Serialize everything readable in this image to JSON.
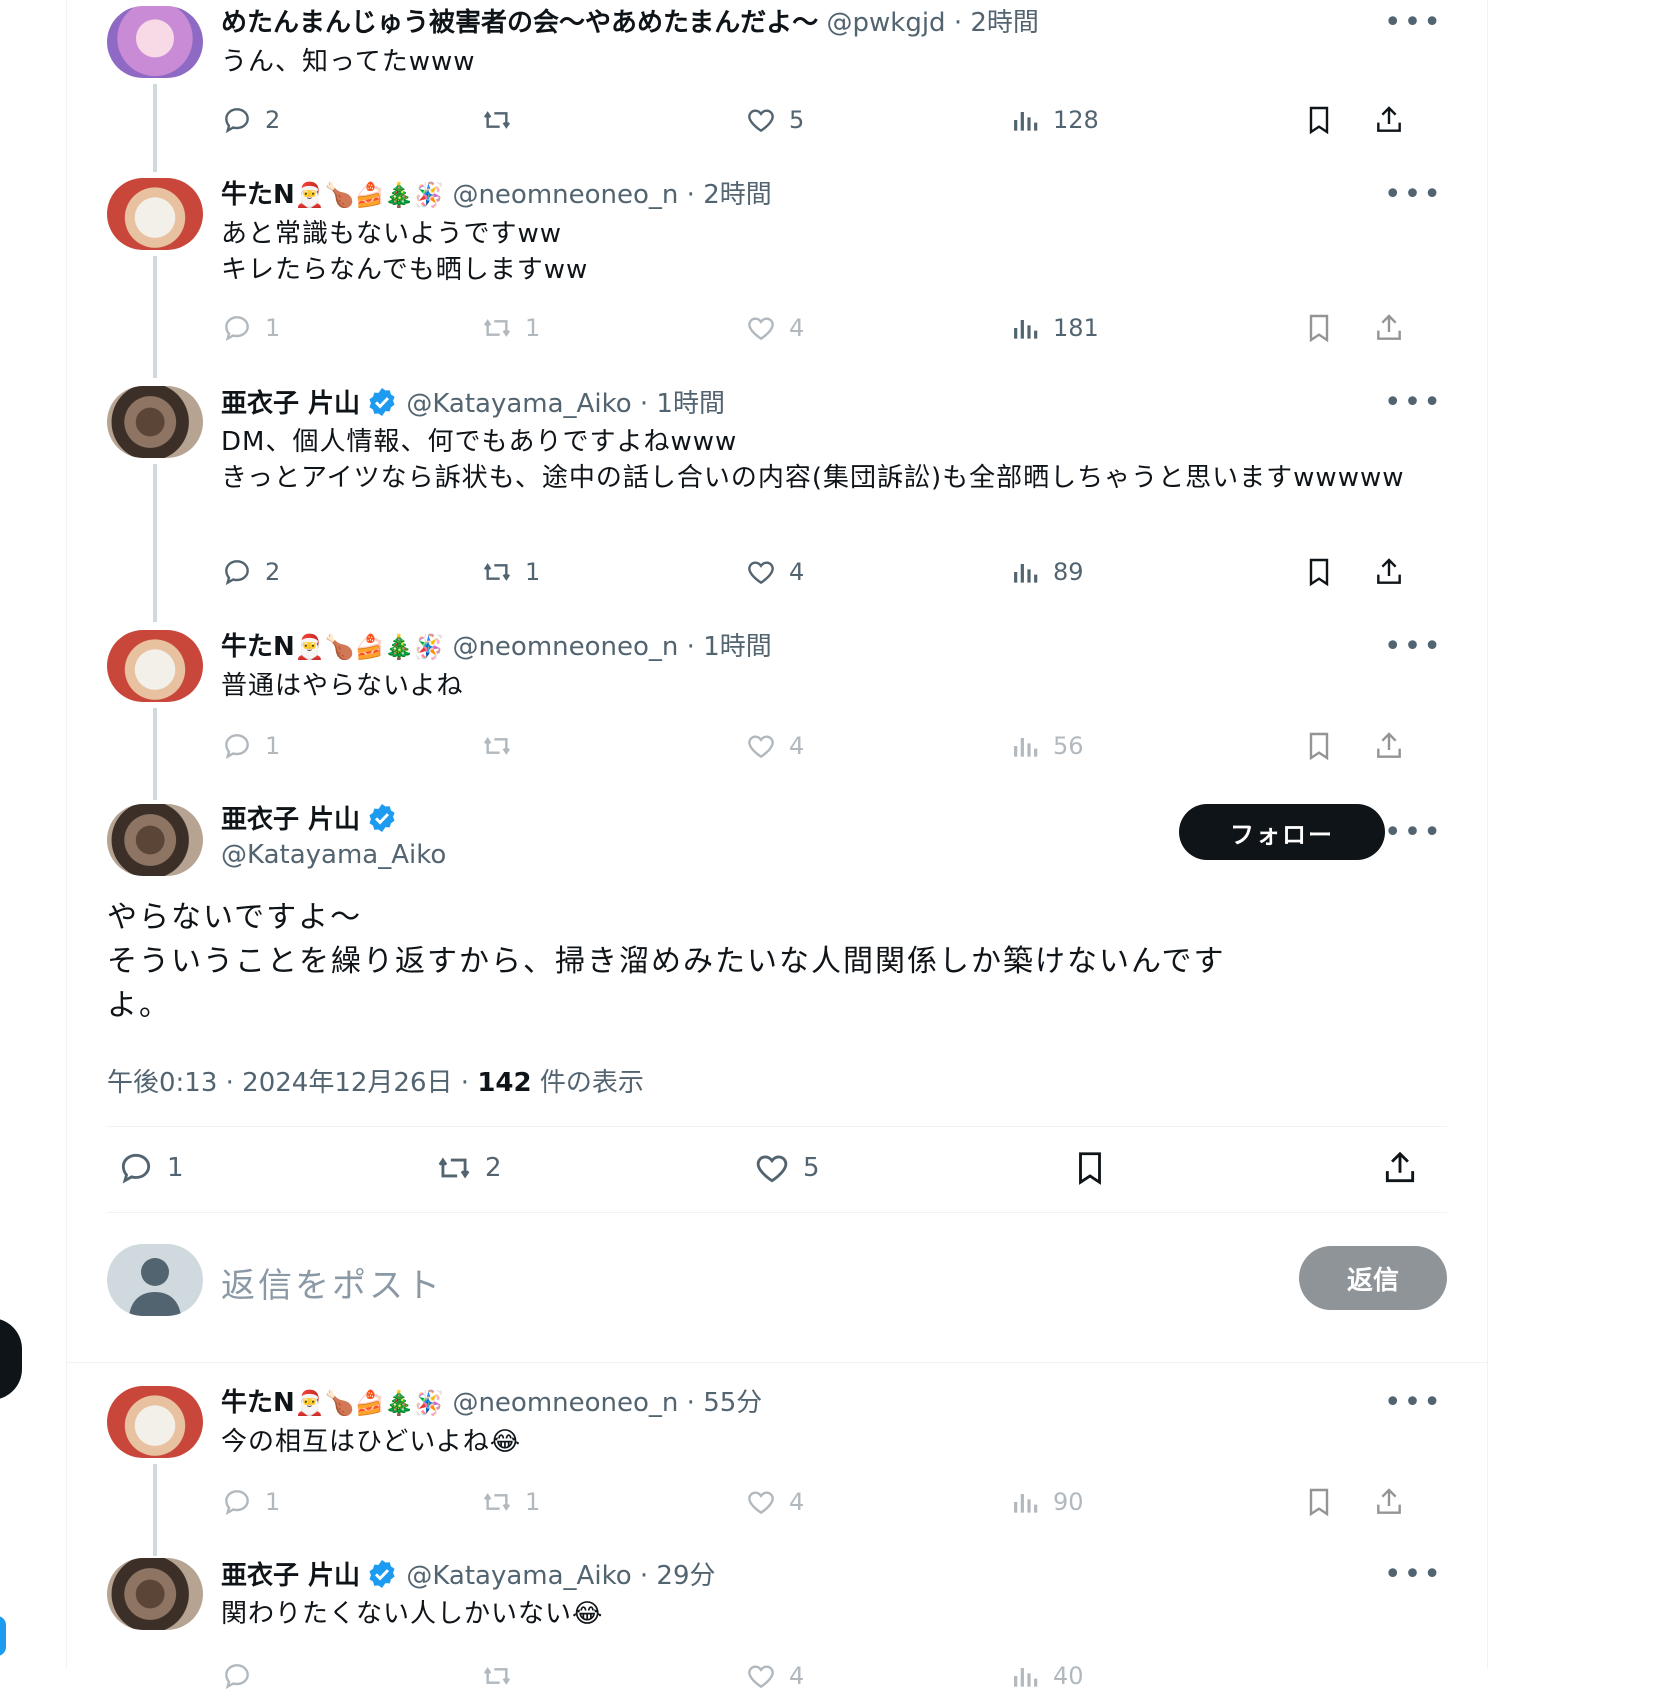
{
  "tweets": [
    {
      "name": "めたんまんじゅう被害者の会〜やあめたまんだよ〜",
      "handle": "@pwkgjd · 2時間",
      "text": "うん、知ってたwww",
      "replies": "2",
      "retweets": "",
      "likes": "5",
      "views": "128"
    },
    {
      "name": "牛たN",
      "emoji": "🎅🍗🍰🎄🪅",
      "handle": "@neomneoneo_n · 2時間",
      "text": "あと常識もないようですww\nキレたらなんでも晒しますww",
      "replies": "1",
      "retweets": "1",
      "likes": "4",
      "views": "181"
    },
    {
      "name": "亜衣子 片山",
      "handle": "@Katayama_Aiko · 1時間",
      "text": "DM、個人情報、何でもありですよねwww\nきっとアイツなら訴状も、途中の話し合いの内容(集団訴訟)も全部晒しちゃうと思いますwwwww",
      "replies": "2",
      "retweets": "1",
      "likes": "4",
      "views": "89"
    },
    {
      "name": "牛たN",
      "emoji": "🎅🍗🍰🎄🪅",
      "handle": "@neomneoneo_n · 1時間",
      "text": "普通はやらないよね",
      "replies": "1",
      "retweets": "",
      "likes": "4",
      "views": "56"
    }
  ],
  "main": {
    "name": "亜衣子 片山",
    "handle": "@Katayama_Aiko",
    "follow_label": "フォロー",
    "text": "やらないですよ〜\nそういうことを繰り返すから、掃き溜めみたいな人間関係しか築けないんです\nよ。",
    "time": "午後0:13 · 2024年12月26日 · ",
    "views_count": "142",
    "views_label": " 件の表示",
    "replies": "1",
    "retweets": "2",
    "likes": "5"
  },
  "reply_box": {
    "placeholder": "返信をポスト",
    "button_label": "返信"
  },
  "replies_below": [
    {
      "name": "牛たN",
      "emoji": "🎅🍗🍰🎄🪅",
      "handle": "@neomneoneo_n · 55分",
      "text": "今の相互はひどいよね😂",
      "replies": "1",
      "retweets": "1",
      "likes": "4",
      "views": "90"
    },
    {
      "name": "亜衣子 片山",
      "handle": "@Katayama_Aiko · 29分",
      "text": "関わりたくない人しかいない😂",
      "likes": "4",
      "views": "40"
    }
  ]
}
